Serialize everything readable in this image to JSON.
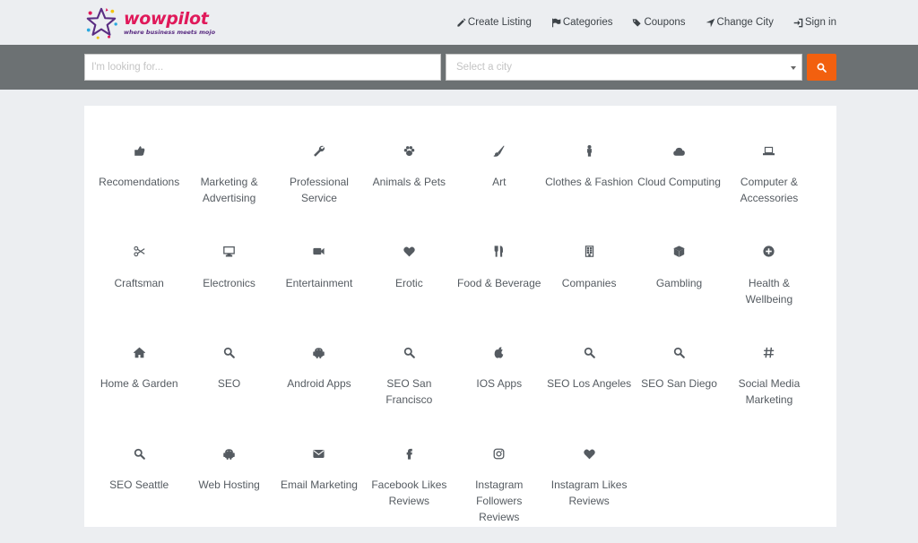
{
  "brand": {
    "name": "wowpilot",
    "tagline": "where business meets mojo"
  },
  "nav": [
    {
      "label": "Create Listing",
      "icon": "pencil-icon"
    },
    {
      "label": "Categories",
      "icon": "flag-icon"
    },
    {
      "label": "Coupons",
      "icon": "tags-icon"
    },
    {
      "label": "Change City",
      "icon": "location-arrow-icon"
    },
    {
      "label": "Sign in",
      "icon": "sign-in-icon"
    }
  ],
  "search": {
    "placeholder": "I'm looking for...",
    "city_placeholder": "Select a city"
  },
  "colors": {
    "accent": "#f2600f",
    "brand": "#e0195a",
    "bar": "#6c7173"
  },
  "categories": [
    {
      "label": "Recomendations",
      "icon": "thumbs-icon"
    },
    {
      "label": "Marketing & Advertising",
      "icon": "none"
    },
    {
      "label": "Professional Service",
      "icon": "wrench-icon"
    },
    {
      "label": "Animals & Pets",
      "icon": "paw-icon"
    },
    {
      "label": "Art",
      "icon": "paintbrush-icon"
    },
    {
      "label": "Clothes & Fashion",
      "icon": "person-icon"
    },
    {
      "label": "Cloud Computing",
      "icon": "cloud-icon"
    },
    {
      "label": "Computer & Accessories",
      "icon": "laptop-icon"
    },
    {
      "label": "Craftsman",
      "icon": "scissors-icon"
    },
    {
      "label": "Electronics",
      "icon": "monitor-icon"
    },
    {
      "label": "Entertainment",
      "icon": "video-camera-icon"
    },
    {
      "label": "Erotic",
      "icon": "heart-icon"
    },
    {
      "label": "Food & Beverage",
      "icon": "cutlery-icon"
    },
    {
      "label": "Companies",
      "icon": "building-icon"
    },
    {
      "label": "Gambling",
      "icon": "cube-icon"
    },
    {
      "label": "Health & Wellbeing",
      "icon": "plus-circle-icon"
    },
    {
      "label": "Home & Garden",
      "icon": "home-icon"
    },
    {
      "label": "SEO",
      "icon": "search-icon"
    },
    {
      "label": "Android Apps",
      "icon": "android-icon"
    },
    {
      "label": "SEO San Francisco",
      "icon": "search-icon"
    },
    {
      "label": "IOS Apps",
      "icon": "apple-icon"
    },
    {
      "label": "SEO Los Angeles",
      "icon": "search-icon"
    },
    {
      "label": "SEO San Diego",
      "icon": "search-icon"
    },
    {
      "label": "Social Media Marketing",
      "icon": "hashtag-icon"
    },
    {
      "label": "SEO Seattle",
      "icon": "search-icon"
    },
    {
      "label": "Web Hosting",
      "icon": "android-icon"
    },
    {
      "label": "Email Marketing",
      "icon": "envelope-icon"
    },
    {
      "label": "Facebook Likes Reviews",
      "icon": "facebook-icon"
    },
    {
      "label": "Instagram Followers Reviews",
      "icon": "instagram-icon"
    },
    {
      "label": "Instagram Likes Reviews",
      "icon": "heart-icon"
    }
  ]
}
